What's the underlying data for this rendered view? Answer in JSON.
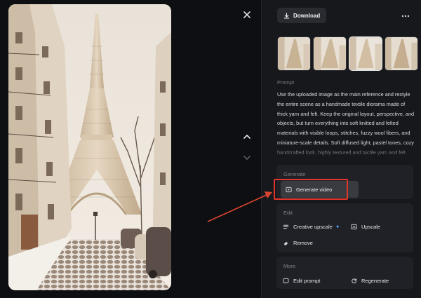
{
  "toolbar": {
    "download_label": "Download",
    "close_icon": "close-icon",
    "more_icon": "more-horizontal-icon"
  },
  "thumbnails": [
    {
      "name": "variant-1",
      "selected": false
    },
    {
      "name": "variant-2",
      "selected": false
    },
    {
      "name": "variant-3",
      "selected": true
    },
    {
      "name": "variant-4",
      "selected": false
    }
  ],
  "prompt": {
    "label": "Prompt",
    "text": "Use the uploaded image as the main reference and restyle the entire scene as a handmade textile diorama made of thick yarn and felt. Keep the original layout, perspective, and objects, but turn everything into soft knitted and felted materials with visible loops, stitches, fuzzy wool fibers, and miniature-scale details. Soft diffused light, pastel tones, cozy handcrafted look, highly textured and tactile yarn and felt materials."
  },
  "generate": {
    "title": "Generate",
    "video_label": "Generate video"
  },
  "edit": {
    "title": "Edit",
    "creative_upscale_label": "Creative upscale",
    "upscale_label": "Upscale",
    "remove_label": "Remove"
  },
  "more": {
    "title": "More",
    "edit_prompt_label": "Edit prompt",
    "regenerate_label": "Regenerate"
  },
  "colors": {
    "background": "#101114",
    "panel": "#17181c",
    "card": "#202126",
    "highlight": "#e0352b",
    "accent_sparkle": "#58a6ff"
  }
}
